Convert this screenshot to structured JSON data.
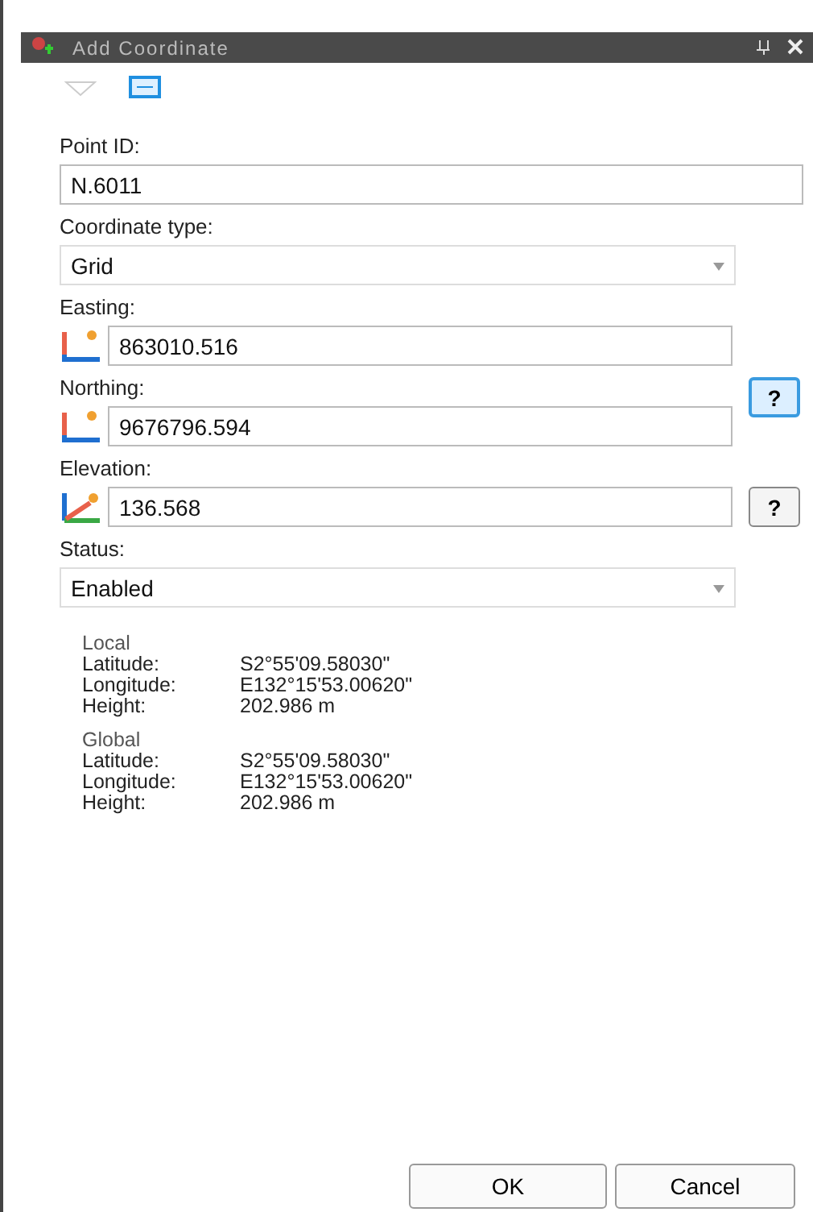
{
  "window": {
    "title": "Add Coordinate"
  },
  "toolbar": [
    {
      "kind": "filter",
      "selected": false
    },
    {
      "kind": "card",
      "selected": true
    }
  ],
  "fields": [
    {
      "kind": "text",
      "label": "Point ID:",
      "value": "N.6011"
    },
    {
      "kind": "combo",
      "label": "Coordinate type:",
      "value": "Grid"
    },
    {
      "kind": "coord",
      "label": "Easting:",
      "value": "863010.516"
    },
    {
      "kind": "coord",
      "label": "Northing:",
      "value": "9676796.594",
      "help": {
        "label": "?",
        "focused": true
      }
    },
    {
      "kind": "height",
      "label": "Elevation:",
      "value": "136.568",
      "help": {
        "label": "?",
        "focused": false
      }
    },
    {
      "kind": "combo",
      "label": "Status:",
      "value": "Enabled"
    }
  ],
  "positions": [
    {
      "title": "Local",
      "rows": [
        {
          "label": "Latitude:",
          "value": "S2°55'09.58030\""
        },
        {
          "label": "Longitude:",
          "value": "E132°15'53.00620\""
        },
        {
          "label": "Height:",
          "value": "202.986 m"
        }
      ]
    },
    {
      "title": "Global",
      "rows": [
        {
          "label": "Latitude:",
          "value": "S2°55'09.58030\""
        },
        {
          "label": "Longitude:",
          "value": "E132°15'53.00620\""
        },
        {
          "label": "Height:",
          "value": "202.986 m"
        }
      ]
    }
  ],
  "buttons": [
    "OK",
    "Cancel"
  ]
}
